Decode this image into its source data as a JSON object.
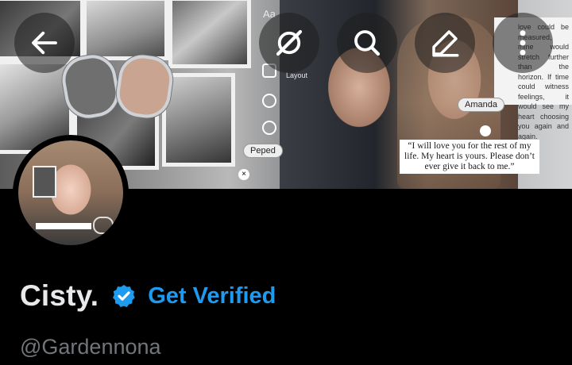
{
  "header": {
    "buttons": {
      "back_icon": "arrow-left-icon",
      "grok_icon": "grok-icon",
      "search_icon": "search-icon",
      "edit_icon": "pencil-icon",
      "more_icon": "more-vertical-icon"
    },
    "banner": {
      "caption": "“I will love you for the rest of my life. My heart is yours. Please don’t ever give it back to me.”",
      "note": "love could be measured, mine would stretch further than the horizon. If time could witness feelings, it would see my heart choosing you again and again.",
      "tag_amanda": "Amanda",
      "tag_peped": "Peped",
      "aa_text": "Aa",
      "layout_text": "Layout"
    }
  },
  "profile": {
    "name": "Cisty.",
    "verified_label": "Get Verified",
    "handle": "@Gardennona",
    "colors": {
      "accent": "#1d9bf0",
      "name": "#e7e9ea",
      "handle": "#71767b",
      "background": "#000000"
    }
  }
}
